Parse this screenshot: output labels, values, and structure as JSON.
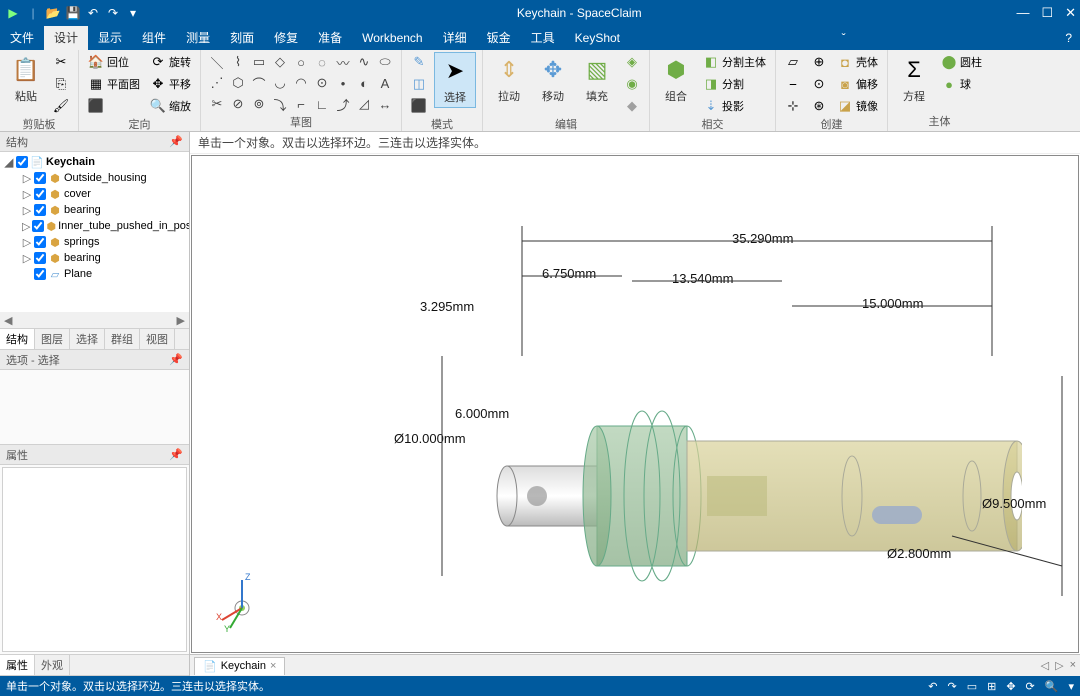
{
  "titlebar": {
    "title": "Keychain - SpaceClaim",
    "qat": [
      "▶",
      "📁",
      "💾",
      "↶",
      "↷",
      "▾"
    ],
    "winbtns": [
      "—",
      "☐",
      "✕"
    ]
  },
  "menubar": {
    "tabs": [
      "文件",
      "设计",
      "显示",
      "组件",
      "测量",
      "刻面",
      "修复",
      "准备",
      "Workbench",
      "详细",
      "钣金",
      "工具",
      "KeyShot"
    ],
    "active": 1,
    "help": "?"
  },
  "ribbon": {
    "groups": {
      "clipboard": {
        "label": "剪贴板",
        "paste": "粘贴"
      },
      "orient": {
        "label": "定向",
        "items": [
          "回位",
          "旋转",
          "平面图",
          "平移",
          "缩放"
        ]
      },
      "sketch": {
        "label": "草图"
      },
      "mode": {
        "label": "模式",
        "select": "选择"
      },
      "edit": {
        "label": "编辑",
        "pull": "拉动",
        "move": "移动",
        "fill": "填充"
      },
      "intersect": {
        "label": "相交",
        "combine": "组合",
        "splitbody": "分割主体",
        "split": "分割",
        "project": "投影"
      },
      "create": {
        "label": "创建",
        "shell": "壳体",
        "offset": "偏移",
        "mirror": "镜像"
      },
      "body": {
        "label": "主体",
        "eq": "方程",
        "cyl": "圆柱",
        "sphere": "球"
      }
    }
  },
  "sidebar": {
    "structure_header": "结构",
    "tree_root": "Keychain",
    "tree_items": [
      "Outside_housing",
      "cover",
      "bearing",
      "Inner_tube_pushed_in_pos",
      "springs",
      "bearing",
      "Plane"
    ],
    "tabs": [
      "结构",
      "图层",
      "选择",
      "群组",
      "视图"
    ],
    "options_header": "选项 - 选择",
    "props_header": "属性",
    "lower_tabs": [
      "属性",
      "外观"
    ]
  },
  "viewport": {
    "hint": "单击一个对象。双击以选择环边。三连击以选择实体。",
    "dimensions": {
      "d1": "35.290mm",
      "d2": "6.750mm",
      "d3": "13.540mm",
      "d4": "15.000mm",
      "d5": "3.295mm",
      "d6": "6.000mm",
      "d7": "Ø10.000mm",
      "d8": "Ø9.500mm",
      "d9": "Ø2.800mm"
    },
    "triad": {
      "x": "X",
      "y": "Y",
      "z": "Z"
    },
    "doc_tab": "Keychain"
  },
  "statusbar": {
    "text": "单击一个对象。双击以选择环边。三连击以选择实体。"
  }
}
